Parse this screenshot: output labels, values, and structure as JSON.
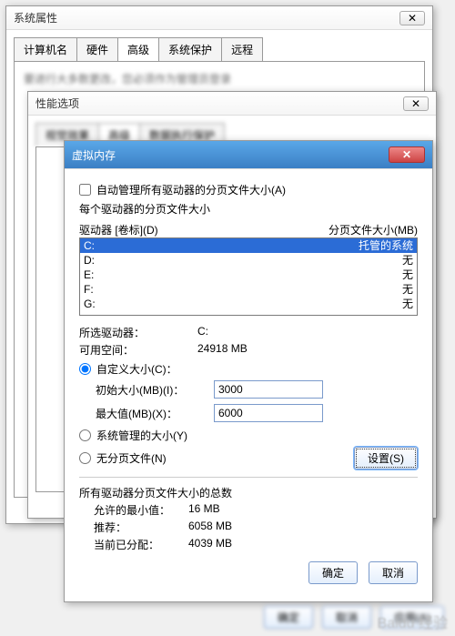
{
  "sys": {
    "title": "系统属性",
    "tabs": [
      "计算机名",
      "硬件",
      "高级",
      "系统保护",
      "远程"
    ],
    "activeTab": 2,
    "blurredLine": "要进行大多数更改，您必须作为管理员登录",
    "footer": {
      "ok": "确定",
      "cancel": "取消",
      "apply": "应用(A)"
    }
  },
  "perf": {
    "title": "性能选项",
    "tabs": [
      "视觉效果",
      "高级",
      "数据执行保护"
    ]
  },
  "vm": {
    "title": "虚拟内存",
    "autoManage": "自动管理所有驱动器的分页文件大小(A)",
    "eachDrive": "每个驱动器的分页文件大小",
    "colDrive": "驱动器 [卷标](D)",
    "colPage": "分页文件大小(MB)",
    "drives": [
      {
        "letter": "C:",
        "page": "托管的系统",
        "selected": true
      },
      {
        "letter": "D:",
        "page": "无",
        "selected": false
      },
      {
        "letter": "E:",
        "page": "无",
        "selected": false
      },
      {
        "letter": "F:",
        "page": "无",
        "selected": false
      },
      {
        "letter": "G:",
        "page": "无",
        "selected": false
      }
    ],
    "selDriveLabel": "所选驱动器：",
    "selDriveValue": "C:",
    "availLabel": "可用空间：",
    "availValue": "24918 MB",
    "radioCustom": "自定义大小(C)：",
    "initLabel": "初始大小(MB)(I)：",
    "initValue": "3000",
    "maxLabel": "最大值(MB)(X)：",
    "maxValue": "6000",
    "radioSys": "系统管理的大小(Y)",
    "radioNone": "无分页文件(N)",
    "setBtn": "设置(S)",
    "totalsHeader": "所有驱动器分页文件大小的总数",
    "minLabel": "允许的最小值：",
    "minValue": "16 MB",
    "recLabel": "推荐：",
    "recValue": "6058 MB",
    "curLabel": "当前已分配：",
    "curValue": "4039 MB",
    "ok": "确定",
    "cancel": "取消"
  },
  "watermark": "Baidu 经验"
}
